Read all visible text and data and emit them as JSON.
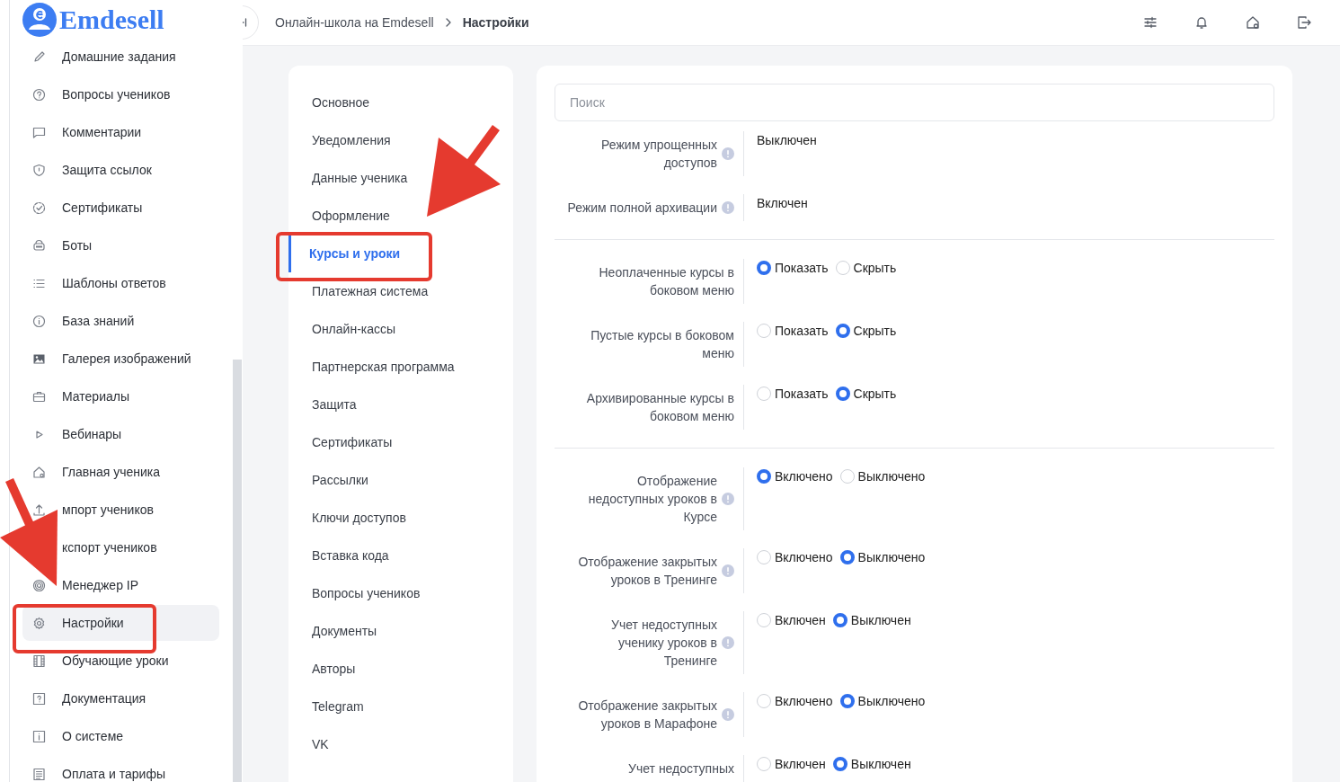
{
  "sidebar": {
    "logo": "Emdesell",
    "items": [
      {
        "label": "Домашние задания",
        "selected": false
      },
      {
        "label": "Вопросы учеников",
        "selected": false
      },
      {
        "label": "Комментарии",
        "selected": false
      },
      {
        "label": "Защита ссылок",
        "selected": false
      },
      {
        "label": "Сертификаты",
        "selected": false
      },
      {
        "label": "Боты",
        "selected": false
      },
      {
        "label": "Шаблоны ответов",
        "selected": false
      },
      {
        "label": "База знаний",
        "selected": false
      },
      {
        "label": "Галерея изображений",
        "selected": false
      },
      {
        "label": "Материалы",
        "selected": false
      },
      {
        "label": "Вебинары",
        "selected": false
      },
      {
        "label": "Главная ученика",
        "selected": false
      },
      {
        "label": "мпорт учеников",
        "selected": false
      },
      {
        "label": "кспорт учеников",
        "selected": false
      },
      {
        "label": "Менеджер IP",
        "selected": false
      },
      {
        "label": "Настройки",
        "selected": true
      },
      {
        "label": "Обучающие уроки",
        "selected": false
      },
      {
        "label": "Документация",
        "selected": false
      },
      {
        "label": "О системе",
        "selected": false
      },
      {
        "label": "Оплата и тарифы",
        "selected": false
      }
    ]
  },
  "header": {
    "breadcrumbs": [
      {
        "label": "Онлайн-школа на Emdesell",
        "current": false
      },
      {
        "label": "Настройки",
        "current": true
      }
    ]
  },
  "settings_nav": {
    "items": [
      {
        "label": "Основное",
        "selected": false
      },
      {
        "label": "Уведомления",
        "selected": false
      },
      {
        "label": "Данные ученика",
        "selected": false
      },
      {
        "label": "Оформление",
        "selected": false
      },
      {
        "label": "Курсы и уроки",
        "selected": true
      },
      {
        "label": "Платежная система",
        "selected": false
      },
      {
        "label": "Онлайн-кассы",
        "selected": false
      },
      {
        "label": "Партнерская программа",
        "selected": false
      },
      {
        "label": "Защита",
        "selected": false
      },
      {
        "label": "Сертификаты",
        "selected": false
      },
      {
        "label": "Рассылки",
        "selected": false
      },
      {
        "label": "Ключи доступов",
        "selected": false
      },
      {
        "label": "Вставка кода",
        "selected": false
      },
      {
        "label": "Вопросы учеников",
        "selected": false
      },
      {
        "label": "Документы",
        "selected": false
      },
      {
        "label": "Авторы",
        "selected": false
      },
      {
        "label": "Telegram",
        "selected": false
      },
      {
        "label": "VK",
        "selected": false
      }
    ]
  },
  "settings": {
    "search": {
      "placeholder": "Поиск"
    },
    "groups": [
      {
        "rows": [
          {
            "kind": "text",
            "label": "Режим упрощенных\nдоступов",
            "info": true,
            "value": "Выключен"
          },
          {
            "kind": "text",
            "label": "Режим полной архивации",
            "info": true,
            "value": "Включен"
          }
        ]
      },
      {
        "rows": [
          {
            "kind": "radio",
            "label": "Неоплаченные курсы в\nбоковом меню",
            "info": false,
            "options": [
              {
                "label": "Показать",
                "selected": true
              },
              {
                "label": "Скрыть",
                "selected": false
              }
            ]
          },
          {
            "kind": "radio",
            "label": "Пустые курсы в боковом\nменю",
            "info": false,
            "options": [
              {
                "label": "Показать",
                "selected": false
              },
              {
                "label": "Скрыть",
                "selected": true
              }
            ]
          },
          {
            "kind": "radio",
            "label": "Архивированные курсы в\nбоковом меню",
            "info": false,
            "options": [
              {
                "label": "Показать",
                "selected": false
              },
              {
                "label": "Скрыть",
                "selected": true
              }
            ]
          }
        ]
      },
      {
        "rows": [
          {
            "kind": "radio",
            "label": "Отображение\nнедоступных уроков в\nКурсе",
            "info": true,
            "options": [
              {
                "label": "Включено",
                "selected": true
              },
              {
                "label": "Выключено",
                "selected": false
              }
            ]
          },
          {
            "kind": "radio",
            "label": "Отображение закрытых\nуроков в Тренинге",
            "info": true,
            "options": [
              {
                "label": "Включено",
                "selected": false
              },
              {
                "label": "Выключено",
                "selected": true
              }
            ]
          },
          {
            "kind": "radio",
            "label": "Учет недоступных\nученику уроков в\nТренинге",
            "info": true,
            "options": [
              {
                "label": "Включен",
                "selected": false
              },
              {
                "label": "Выключен",
                "selected": true
              }
            ]
          },
          {
            "kind": "radio",
            "label": "Отображение закрытых\nуроков в Марафоне",
            "info": true,
            "options": [
              {
                "label": "Включено",
                "selected": false
              },
              {
                "label": "Выключено",
                "selected": true
              }
            ]
          },
          {
            "kind": "radio",
            "label": "Учет недоступных",
            "info": false,
            "options": [
              {
                "label": "Включен",
                "selected": false
              },
              {
                "label": "Выключен",
                "selected": true
              }
            ]
          }
        ]
      }
    ]
  },
  "annotations": [
    {
      "kind": "arrow"
    },
    {
      "kind": "arrow"
    },
    {
      "kind": "frame"
    },
    {
      "kind": "frame"
    }
  ]
}
